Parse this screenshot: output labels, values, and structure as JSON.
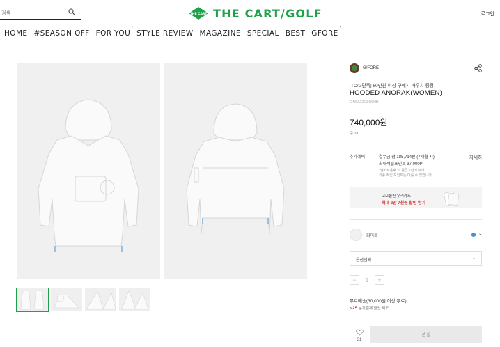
{
  "header": {
    "search_placeholder": "검색",
    "logo_emblem_text": "THE CART",
    "logo_text": "THE CART/GOLF",
    "login_label": "로그인",
    "nav": [
      {
        "label": "HOME",
        "mark": ""
      },
      {
        "label": "#SEASON OFF",
        "mark": ""
      },
      {
        "label": "FOR YOU",
        "mark": "'"
      },
      {
        "label": "STYLE REVIEW",
        "mark": ""
      },
      {
        "label": "MAGAZINE",
        "mark": ""
      },
      {
        "label": "SPECIAL",
        "mark": ""
      },
      {
        "label": "BEST",
        "mark": ""
      },
      {
        "label": "GFORE",
        "mark": "'"
      }
    ]
  },
  "product": {
    "brand": "G/FORE",
    "promo_text": "[TC/G단독] 60만원 이상 구매시 파우치 증정",
    "title": "HOODED ANORAK(WOMEN)",
    "code": "G4WA22O34WHH",
    "price": "740,000원",
    "sub_count": "쿠 31",
    "benefits": {
      "label": "추가혜택",
      "main": "결무금 점 185,714원 (7개월 시)",
      "sub": "최대적립포인트 37,000P",
      "note_line1": "*멤버적용후 의 등급 1만에 따라",
      "note_line2": "최종 적립 포인트는 다를 수 있습니다.",
      "detail_link": "자세히"
    },
    "card_banner": {
      "line1": "고오올원 우리카드",
      "line2": "최대 2만 7천원 할인 받기"
    },
    "color": {
      "name": "화이트",
      "dot_color": "#4a90d9"
    },
    "option_select": {
      "label": "옵션선택"
    },
    "quantity": {
      "value": "1",
      "minus": "−",
      "plus": "+"
    },
    "shipping": {
      "line1": "무료배송(30,000원 이상 무료)",
      "pay_badge": "N",
      "pay_num": "25",
      "line2": "분기결제 할인 제도"
    },
    "likes": "31",
    "buy_label": "품절"
  },
  "colors": {
    "brand_green": "#1fa14a"
  }
}
